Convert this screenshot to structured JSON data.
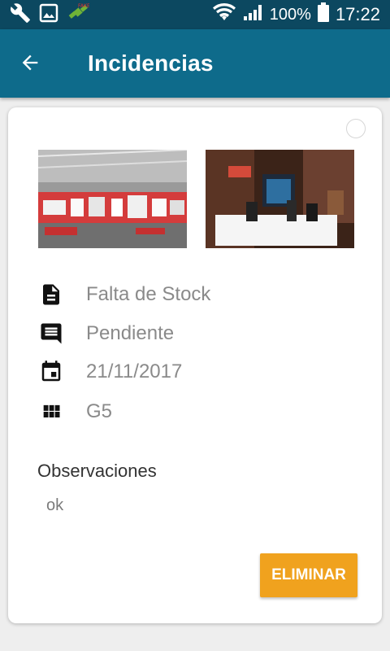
{
  "status_bar": {
    "battery": "100%",
    "time": "17:22",
    "left_icons": [
      "wrench-icon",
      "image-icon",
      "satellite-icon"
    ],
    "right_icons": [
      "wifi-icon",
      "signal-icon",
      "battery-icon"
    ]
  },
  "app_bar": {
    "title": "Incidencias",
    "back_icon": "arrow-back-icon",
    "color": "#0e6b8b"
  },
  "card": {
    "photos": [
      "photo-store-shelves",
      "photo-phone-display"
    ],
    "details": [
      {
        "icon": "document-icon",
        "text": "Falta de Stock"
      },
      {
        "icon": "comment-icon",
        "text": "Pendiente"
      },
      {
        "icon": "calendar-icon",
        "text": "21/11/2017"
      },
      {
        "icon": "grid-icon",
        "text": "G5"
      }
    ],
    "observations_label": "Observaciones",
    "observations_value": "ok",
    "delete_label": "ELIMINAR",
    "delete_color": "#f0a21e"
  }
}
